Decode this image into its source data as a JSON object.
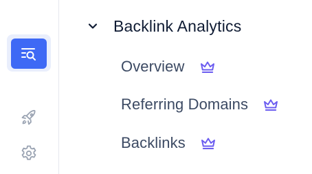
{
  "rail": {
    "items": [
      {
        "icon": "search-list-icon",
        "active": true
      },
      {
        "icon": "rocket-icon",
        "active": false
      },
      {
        "icon": "gear-icon",
        "active": false
      }
    ],
    "accent_color": "#3e69f5",
    "active_bg_color": "#e9eefc"
  },
  "menu": {
    "group": {
      "title": "Backlink Analytics",
      "expanded": true,
      "chevron_icon": "chevron-down-icon"
    },
    "items": [
      {
        "label": "Overview",
        "badge_icon": "crown-icon"
      },
      {
        "label": "Referring Domains",
        "badge_icon": "crown-icon"
      },
      {
        "label": "Backlinks",
        "badge_icon": "crown-icon"
      }
    ],
    "badge_color": "#6b5cf0"
  }
}
